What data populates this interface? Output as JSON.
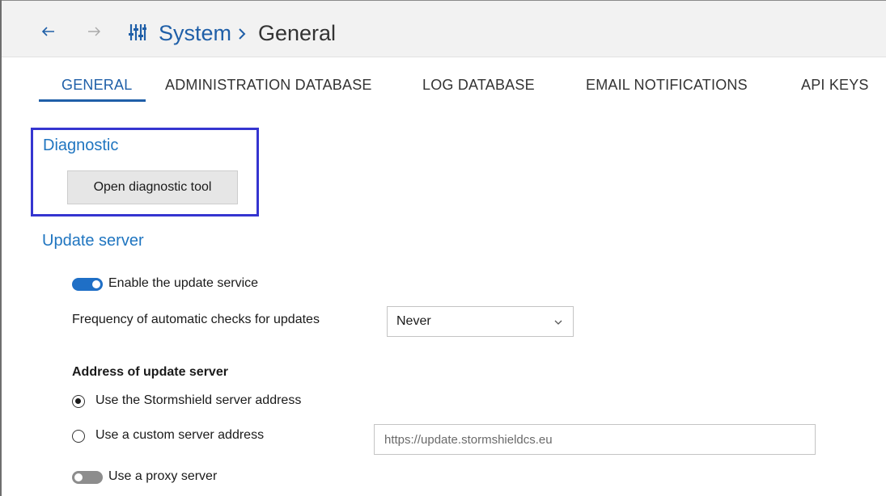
{
  "header": {
    "breadcrumb": [
      "System",
      "General"
    ],
    "back_icon": "arrow-left-icon",
    "forward_icon": "arrow-right-icon",
    "system_icon": "sliders-icon"
  },
  "tabs": [
    {
      "label": "GENERAL",
      "active": true
    },
    {
      "label": "ADMINISTRATION DATABASE",
      "active": false
    },
    {
      "label": "LOG DATABASE",
      "active": false
    },
    {
      "label": "EMAIL NOTIFICATIONS",
      "active": false
    },
    {
      "label": "API KEYS",
      "active": false
    }
  ],
  "diagnostic": {
    "title": "Diagnostic",
    "button_label": "Open diagnostic tool"
  },
  "update_server": {
    "title": "Update server",
    "enable_label": "Enable the update service",
    "enable_on": true,
    "frequency_label": "Frequency of automatic checks for updates",
    "frequency_value": "Never",
    "address_heading": "Address of update server",
    "radio_default_label": "Use the Stormshield server address",
    "radio_default_selected": true,
    "radio_custom_label": "Use a custom server address",
    "radio_custom_selected": false,
    "custom_address_placeholder": "https://update.stormshieldcs.eu",
    "proxy_label": "Use a proxy server",
    "proxy_on": false
  },
  "colors": {
    "accent": "#1f5fa8",
    "section_title": "#1f75c0",
    "highlight_border": "#3535d0",
    "toggle_on": "#1f6fc6",
    "toggle_off": "#8d8d8d"
  }
}
